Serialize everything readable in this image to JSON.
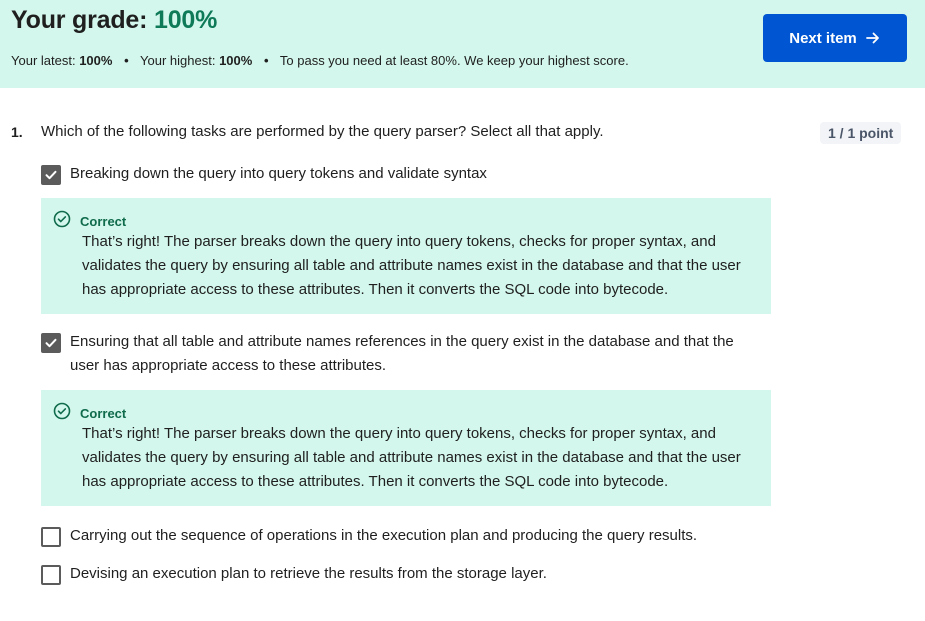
{
  "header": {
    "grade_label": "Your grade:",
    "grade_value": "100%",
    "latest_label": "Your latest:",
    "latest_value": "100%",
    "highest_label": "Your highest:",
    "highest_value": "100%",
    "pass_text": "To pass you need at least 80%. We keep your highest score.",
    "next_button": "Next item"
  },
  "question": {
    "number": "1.",
    "text": "Which of the following tasks are performed by the query parser? Select all that apply.",
    "points": "1 / 1 point",
    "options": [
      {
        "label": "Breaking down the query into query tokens and validate syntax",
        "checked": true,
        "feedback_label": "Correct",
        "feedback_text": "That’s right! The parser breaks down the query into query tokens, checks for proper syntax, and validates the query by ensuring all table and attribute names exist in the database and that the user has appropriate access to these attributes. Then it converts the SQL code into bytecode."
      },
      {
        "label": "Ensuring that all table and attribute names references in the query exist in the database and that the user has appropriate access to these attributes.",
        "checked": true,
        "feedback_label": "Correct",
        "feedback_text": "That’s right! The parser breaks down the query into query tokens, checks for proper syntax, and validates the query by ensuring all table and attribute names exist in the database and that the user has appropriate access to these attributes. Then it converts the SQL code into bytecode."
      },
      {
        "label": "Carrying out the sequence of operations in the execution plan and producing the query results.",
        "checked": false
      },
      {
        "label": "Devising an execution plan to retrieve the results from the storage layer.",
        "checked": false
      }
    ]
  },
  "icons": {
    "arrow": "arrow-right-icon",
    "check": "checkmark-icon",
    "correct": "check-circle-icon"
  },
  "colors": {
    "banner_bg": "#d3f7ec",
    "grade_green": "#0f7a57",
    "button_blue": "#0056d2",
    "checkbox_gray": "#5b5b5b"
  }
}
